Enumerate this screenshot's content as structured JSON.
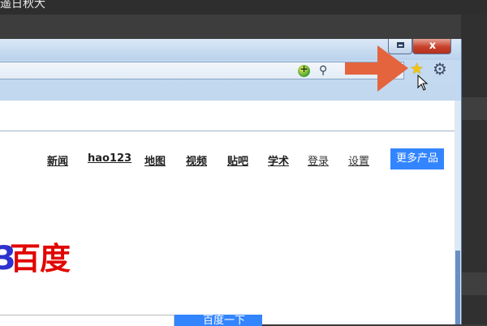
{
  "window_title_partial": "遥日秋大",
  "window_controls": {
    "maximize_label": "",
    "close_label": "x"
  },
  "toolbar": {
    "compat_symbol": "+",
    "search_symbol": "⚲",
    "favorites_symbol": "★",
    "tools_symbol": "⚙"
  },
  "page": {
    "nav": [
      "新闻",
      "hao123",
      "地图",
      "视频",
      "贴吧",
      "学术",
      "登录",
      "设置"
    ],
    "more_button": "更多产品",
    "logo_text": "百度",
    "search_button": "百度一下"
  },
  "colors": {
    "accent": "#3385ff",
    "logo_red": "#e10601",
    "logo_blue": "#2e32cd",
    "annotation_arrow": "#e4643e",
    "star": "#f4c20d"
  }
}
